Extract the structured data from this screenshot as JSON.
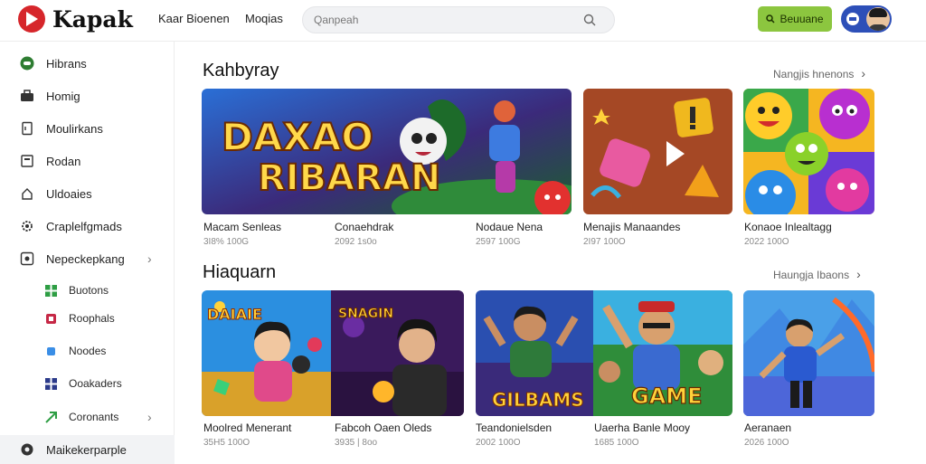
{
  "app": {
    "logo_text": "Kapak"
  },
  "header": {
    "nav": [
      "Kaar Bioenen",
      "Moqias"
    ],
    "search_placeholder": "Qanpeah",
    "cta_label": "Beuuane"
  },
  "sidebar": {
    "items": [
      {
        "label": "Hibrans",
        "icon": "gamepad-icon"
      },
      {
        "label": "Homig",
        "icon": "briefcase-icon"
      },
      {
        "label": "Moulirkans",
        "icon": "document-icon"
      },
      {
        "label": "Rodan",
        "icon": "screen-icon"
      },
      {
        "label": "Uldoaies",
        "icon": "upload-icon"
      },
      {
        "label": "Craplelfgmads",
        "icon": "gear-icon"
      },
      {
        "label": "Nepeckepkang",
        "icon": "target-icon"
      }
    ],
    "subitems": [
      {
        "label": "Buotons",
        "icon": "grid-icon"
      },
      {
        "label": "Roophals",
        "icon": "puzzle-icon"
      },
      {
        "label": "Noodes",
        "icon": "square-icon"
      },
      {
        "label": "Ooakaders",
        "icon": "grid-icon"
      },
      {
        "label": "Coronants",
        "icon": "arrow-icon"
      }
    ],
    "footer": {
      "label": "Maikekerparple",
      "icon": "globe-icon"
    }
  },
  "sections": [
    {
      "title": "Kahbyray",
      "see_all": "Nangjis hnenons",
      "cards": [
        {
          "title": "Macam Senleas",
          "meta": "3I8% 100G",
          "banner": "RIBARAN",
          "banner_top": "DAXAO"
        },
        {
          "title": "Conaehdrak",
          "meta": "2092 1s0o"
        },
        {
          "title": "Nodaue Nena",
          "meta": "2597 100G"
        },
        {
          "title": "Menajis Manaandes",
          "meta": "2I97 100O"
        },
        {
          "title": "Konaoe Inlealtagg",
          "meta": "2022 100O"
        }
      ]
    },
    {
      "title": "Hiaquarn",
      "see_all": "Haungja Ibaons",
      "cards": [
        {
          "title": "Moolred Menerant",
          "meta": "35H5 100O",
          "banner": "DAIAIE"
        },
        {
          "title": "Fabcoh Oaen Oleds",
          "meta": "3935 | 8oo",
          "banner": "SNAGIN"
        },
        {
          "title": "Teandonielsden",
          "meta": "2002 100O",
          "banner": "GILBAMS"
        },
        {
          "title": "Uaerha Banle Mooy",
          "meta": "1685 100O",
          "banner": "GAME"
        },
        {
          "title": "Aeranaen",
          "meta": "2026 100O"
        }
      ]
    }
  ]
}
